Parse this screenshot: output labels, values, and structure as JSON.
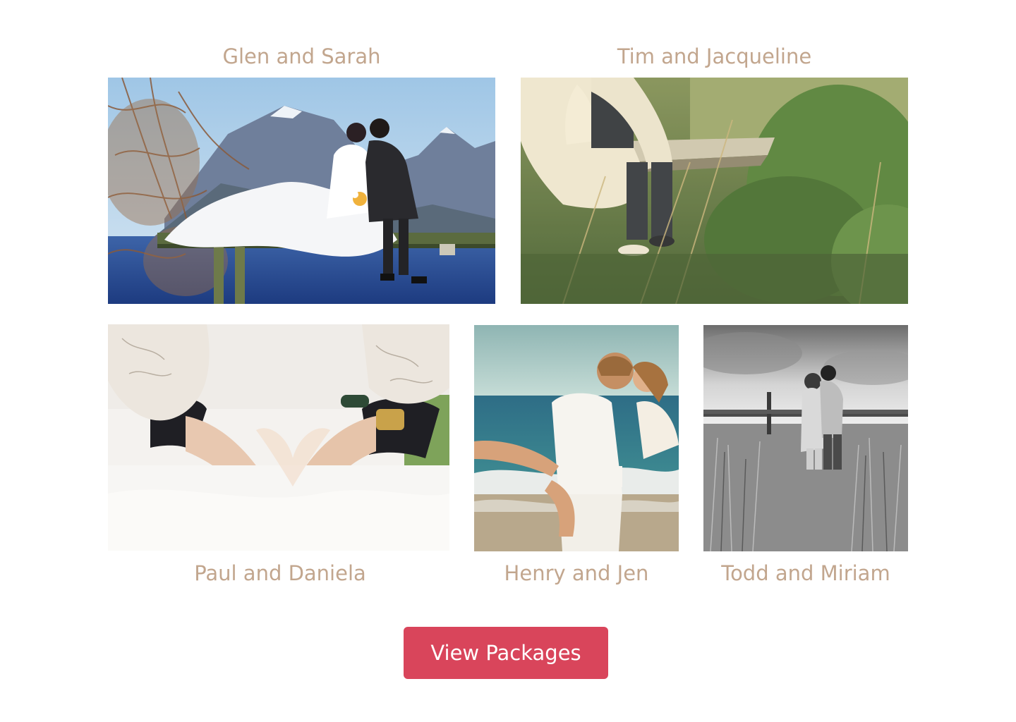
{
  "gallery": {
    "couples": [
      {
        "name": "Glen and Sarah",
        "photo": "couple-on-pier-mountain-lake-photo"
      },
      {
        "name": "Tim and Jacqueline",
        "photo": "couple-sitting-on-dock-grass-photo"
      },
      {
        "name": "Paul and Daniela",
        "photo": "heart-hands-wedding-dress-photo"
      },
      {
        "name": "Henry and Jen",
        "photo": "couple-beach-embrace-photo"
      },
      {
        "name": "Todd and Miriam",
        "photo": "black-white-couple-field-photo"
      }
    ]
  },
  "cta": {
    "label": "View Packages",
    "color": "#d9455b"
  },
  "colors": {
    "caption": "#c2a68e",
    "background": "#ffffff"
  }
}
